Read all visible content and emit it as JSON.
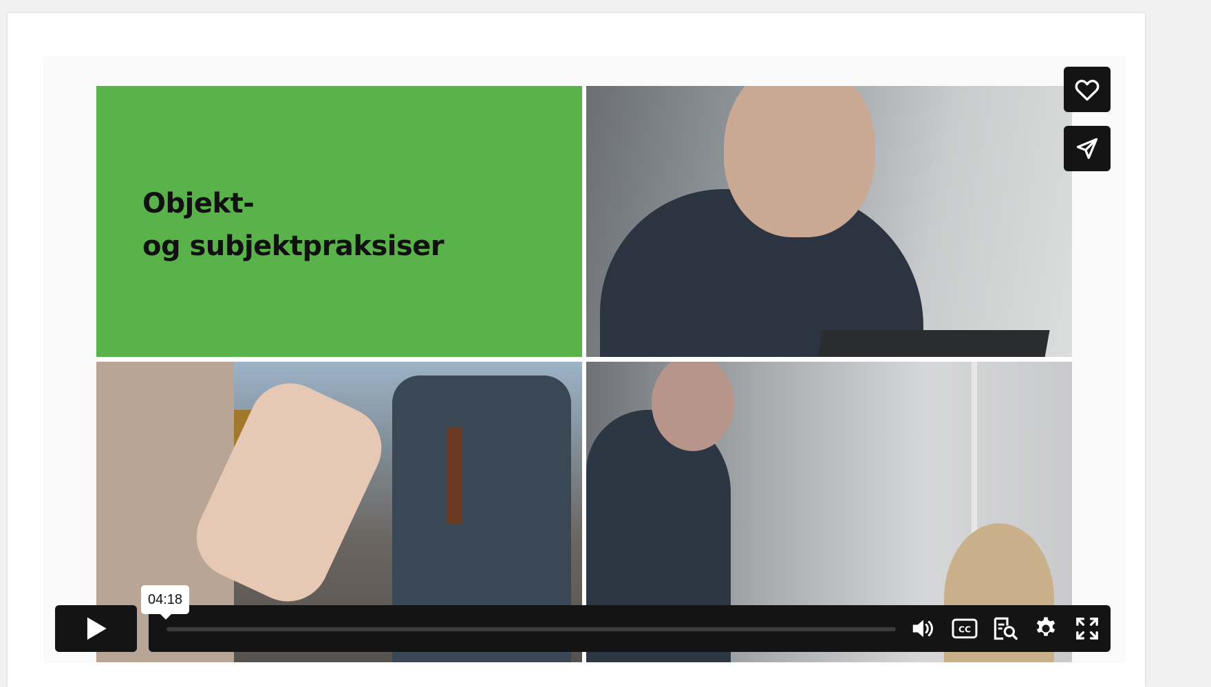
{
  "video": {
    "title_line1": "Objekt-",
    "title_line2": "og subjektpraksiser"
  },
  "actions": {
    "like_icon": "heart-icon",
    "share_icon": "paper-plane-icon"
  },
  "controls": {
    "play_icon": "play-icon",
    "time_tooltip": "04:18",
    "progress_fraction": 0,
    "icons": [
      "volume-icon",
      "closed-captions-icon",
      "transcript-icon",
      "settings-gear-icon",
      "fullscreen-icon"
    ]
  },
  "colors": {
    "title_green": "#5ab24a",
    "control_bg": "#141414"
  }
}
